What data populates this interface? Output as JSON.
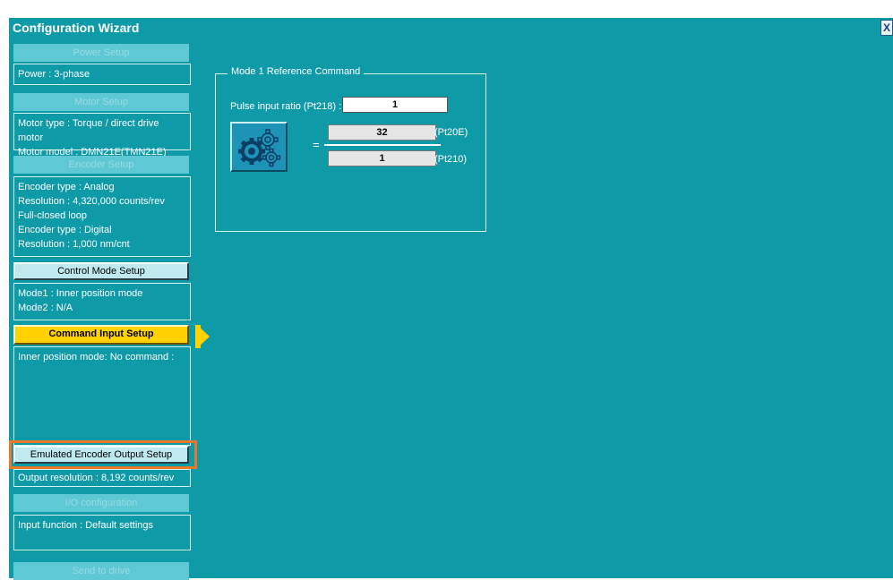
{
  "window": {
    "title": "Configuration Wizard",
    "close_label": "X"
  },
  "sidebar": {
    "power_setup": {
      "label": "Power Setup",
      "lines": [
        "Power :  3-phase"
      ]
    },
    "motor_setup": {
      "label": "Motor Setup",
      "lines": [
        "Motor type : Torque / direct drive motor",
        "Motor model  : DMN21E(TMN21E)"
      ]
    },
    "encoder_setup": {
      "label": "Encoder Setup",
      "lines": [
        "Encoder type : Analog",
        "Resolution : 4,320,000 counts/rev",
        "Full-closed loop",
        "Encoder type : Digital",
        "Resolution : 1,000 nm/cnt"
      ]
    },
    "control_mode_setup": {
      "label": "Control Mode Setup",
      "lines": [
        "Mode1 : Inner position mode",
        "Mode2 : N/A"
      ]
    },
    "command_input_setup": {
      "label": "Command Input Setup",
      "lines": [
        "Inner position mode: No command :"
      ]
    },
    "emulated_encoder_setup": {
      "label": "Emulated Encoder Output Setup",
      "lines": [
        "Output resolution : 8,192 counts/rev"
      ]
    },
    "io_configuration": {
      "label": "I/O configuration",
      "lines": [
        "Input function : Default settings"
      ]
    },
    "send_to_drive": {
      "label": "Send to drive"
    }
  },
  "main": {
    "group_title": "Mode 1 Reference Command",
    "pulse_ratio_label": "Pulse input ratio (Pt218) :",
    "pulse_ratio_value": "1",
    "equals": "=",
    "numerator_value": "32",
    "numerator_param": "(Pt20E)",
    "denominator_value": "1",
    "denominator_param": "(Pt210)"
  },
  "colors": {
    "background": "#0e9aa7",
    "active": "#ffd200",
    "highlight": "#e8792b"
  },
  "icons": {
    "gear_button": "gears-icon"
  }
}
